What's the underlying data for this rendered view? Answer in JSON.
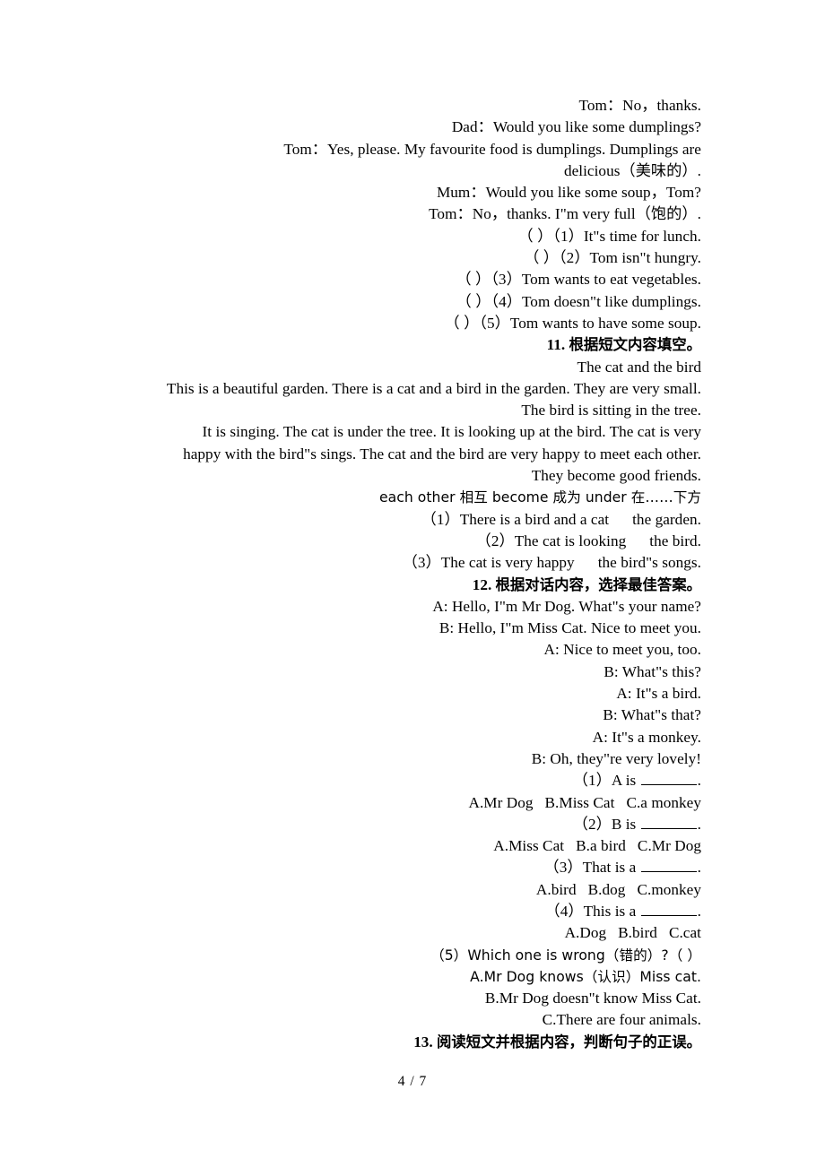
{
  "page": {
    "footer": "4 / 7"
  },
  "dialogue_top": {
    "lines": [
      "Tom：No，thanks.",
      "Dad：Would you like some dumplings?",
      "Tom：Yes, please. My favourite food is dumplings. Dumplings are",
      "delicious（美味的）.",
      "Mum：Would you like some soup，Tom?",
      "Tom：No，thanks. I\"m very full（饱的）."
    ]
  },
  "truefalse_top": {
    "items": [
      "（ ）（1）It\"s time for lunch.",
      "（ ）（2）Tom isn\"t hungry.",
      "（ ）（3）Tom wants to eat vegetables.",
      "（ ）（4）Tom doesn\"t like dumplings.",
      "（ ）（5）Tom wants to have some soup."
    ]
  },
  "section11": {
    "number": "11.",
    "title": "根据短文内容填空。",
    "passage_title": "The cat and the bird",
    "passage_lines": [
      "This is a beautiful garden. There is a cat and a bird in the garden. They are very small.",
      "The bird is sitting in the tree.",
      "It is singing. The cat is under the tree. It is looking up at the bird. The cat is very",
      "happy with the bird\"s sings. The cat and the bird are very happy to meet each other.",
      "They become good friends."
    ],
    "vocabulary": "each other 相互 become 成为 under 在……下方",
    "questions": [
      {
        "prefix": "（1）There is a bird and a cat",
        "suffix": "the garden."
      },
      {
        "prefix": "（2）The cat is looking",
        "suffix": "the bird."
      },
      {
        "prefix": "（3）The cat is very happy",
        "suffix": "the bird\"s songs."
      }
    ]
  },
  "section12": {
    "number": "12.",
    "title": "根据对话内容，选择最佳答案。",
    "dialogue": [
      "A: Hello, I\"m Mr Dog. What\"s your name?",
      "B: Hello, I\"m Miss Cat. Nice to meet you.",
      "A: Nice to meet you, too.",
      "B: What\"s this?",
      "A: It\"s a bird.",
      "B: What\"s that?",
      "A: It\"s a monkey.",
      "B: Oh, they\"re very lovely!"
    ],
    "questions": [
      {
        "stem_prefix": "（1）A is ",
        "stem_suffix": ".",
        "has_blank": true,
        "options": "A.Mr Dog   B.Miss Cat   C.a monkey"
      },
      {
        "stem_prefix": "（2）B is ",
        "stem_suffix": ".",
        "has_blank": true,
        "options": "A.Miss Cat   B.a bird   C.Mr Dog"
      },
      {
        "stem_prefix": "（3）That is a ",
        "stem_suffix": ".",
        "has_blank": true,
        "options": "A.bird   B.dog   C.monkey"
      },
      {
        "stem_prefix": "（4）This is a ",
        "stem_suffix": ".",
        "has_blank": true,
        "options": "A.Dog   B.bird   C.cat"
      }
    ],
    "question5": {
      "stem": "（5）Which one is wrong（错的）?（ ）",
      "options": [
        "A.Mr Dog knows（认识）Miss cat.",
        "B.Mr Dog doesn\"t know Miss Cat.",
        "C.There are four animals."
      ]
    }
  },
  "section13": {
    "number": "13.",
    "title": "阅读短文并根据内容，判断句子的正误。"
  }
}
